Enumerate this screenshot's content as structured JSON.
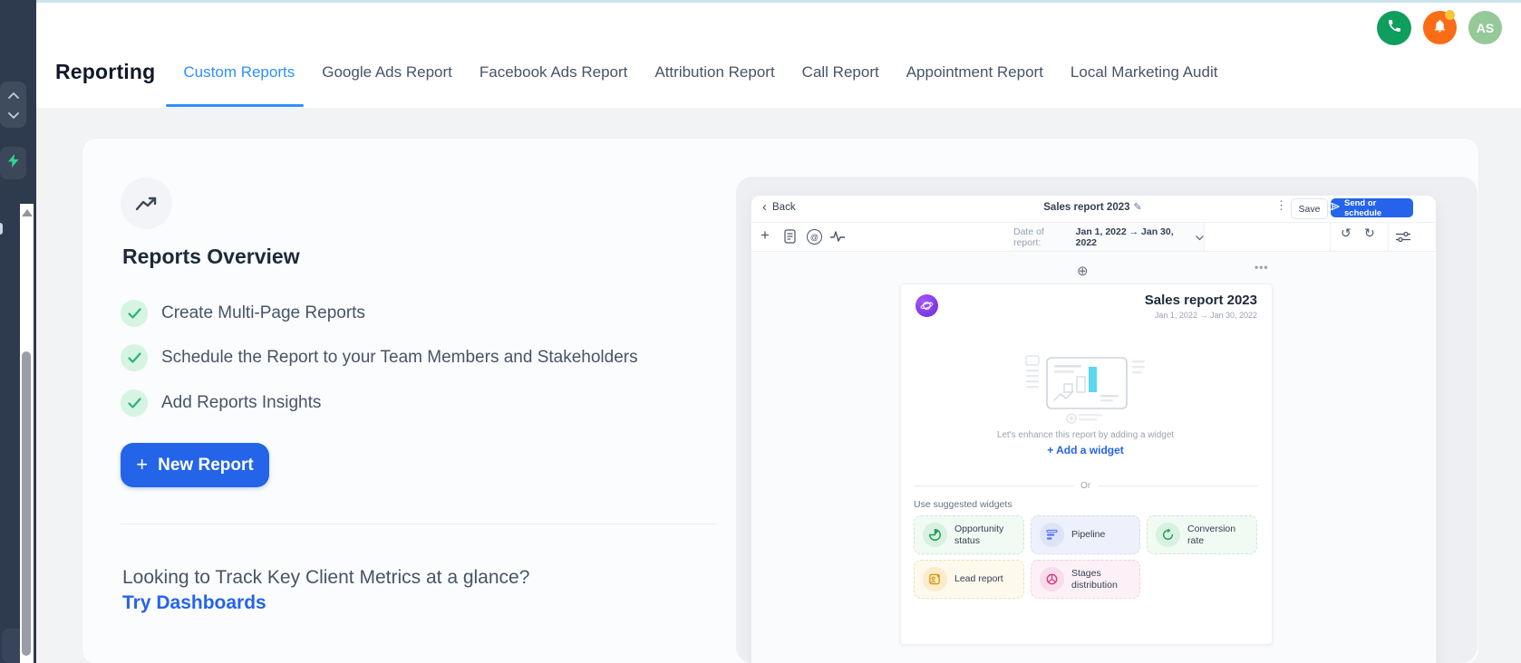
{
  "page": {
    "background": "#f2f3f5",
    "topline_color": "#cde3ea"
  },
  "header": {
    "title": "Reporting",
    "tabs": [
      {
        "label": "Custom Reports",
        "active": true
      },
      {
        "label": "Google Ads Report",
        "active": false
      },
      {
        "label": "Facebook Ads Report",
        "active": false
      },
      {
        "label": "Attribution Report",
        "active": false
      },
      {
        "label": "Call Report",
        "active": false
      },
      {
        "label": "Appointment Report",
        "active": false
      },
      {
        "label": "Local Marketing Audit",
        "active": false
      }
    ],
    "active_tab_color": "#2e90fa",
    "phone_button_color": "#0f9e5d",
    "bell_button_color": "#fa6c16",
    "bell_badge_color": "#fcc33c",
    "avatar_initials": "AS",
    "avatar_color": "#95c998"
  },
  "overview": {
    "heading": "Reports Overview",
    "features": [
      "Create Multi-Page Reports",
      "Schedule the Report to your Team Members and Stakeholders",
      "Add Reports Insights"
    ],
    "check_color": "#27b376",
    "new_report_label": "New Report",
    "new_report_color": "#2364e8",
    "footer_question": "Looking to Track Key Client Metrics at a glance?",
    "footer_link": "Try Dashboards",
    "link_color": "#2563eb"
  },
  "editor": {
    "back_label": "Back",
    "title": "Sales report 2023",
    "save_label": "Save",
    "send_label": "Send or schedule",
    "send_color": "#2563eb",
    "date_label": "Date of report:",
    "date_value": "Jan 1, 2022 → Jan 30, 2022",
    "canvas": {
      "title": "Sales report 2023",
      "date_range": "Jan 1, 2022 → Jan 30, 2022",
      "empty_hint": "Let's enhance this report by adding a widget",
      "add_widget_label": "Add a widget",
      "or_label": "Or",
      "suggested_label": "Use suggested widgets",
      "chart_bar_color": "#5bd7ef",
      "widgets": [
        {
          "label": "Opportunity status",
          "icon": "pie-chart-icon",
          "color": "#1f9d57"
        },
        {
          "label": "Pipeline",
          "icon": "funnel-icon",
          "color": "#5873ee"
        },
        {
          "label": "Conversion rate",
          "icon": "refresh-icon",
          "color": "#1f9d57"
        },
        {
          "label": "Lead report",
          "icon": "lead-card-icon",
          "color": "#d9930d"
        },
        {
          "label": "Stages distribution",
          "icon": "donut-icon",
          "color": "#d6387f"
        }
      ]
    }
  },
  "glyphs": {
    "plus": "+",
    "kebab": "⋮",
    "back": "‹",
    "pencil": "✎",
    "undo": "↺",
    "redo": "↻",
    "add_page": "⊕",
    "ellipsis": "•••",
    "at": "@"
  }
}
